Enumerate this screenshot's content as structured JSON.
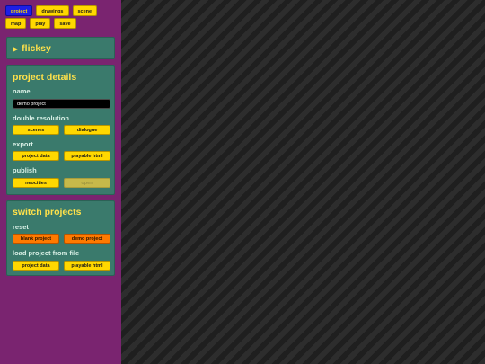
{
  "nav": {
    "buttons": [
      {
        "label": "project",
        "active": true
      },
      {
        "label": "drawings",
        "active": false
      },
      {
        "label": "scene",
        "active": false
      },
      {
        "label": "map",
        "active": false
      },
      {
        "label": "play",
        "active": false
      },
      {
        "label": "save",
        "active": false
      }
    ]
  },
  "flicksy_panel": {
    "arrow": "▶",
    "title": "flicksy"
  },
  "project_details": {
    "title": "project details",
    "name_label": "name",
    "name_value": "demo project",
    "double_resolution_label": "double resolution",
    "double_resolution_buttons": [
      "scenes",
      "dialogue"
    ],
    "export_label": "export",
    "export_buttons": [
      "project data",
      "playable html"
    ],
    "publish_label": "publish",
    "publish_buttons": [
      "neocities",
      "open"
    ]
  },
  "switch_projects": {
    "title": "switch projects",
    "reset_label": "reset",
    "reset_buttons": [
      "blank project",
      "demo project"
    ],
    "load_label": "load project from file",
    "load_buttons": [
      "project data",
      "playable html"
    ]
  },
  "colors": {
    "sidebar": "#7a2470",
    "panel": "#3a7a6c",
    "title_yellow": "#ffe14a",
    "button_yellow": "#ffd800",
    "active_blue": "#1e1ee6",
    "orange": "#ff7a00"
  }
}
